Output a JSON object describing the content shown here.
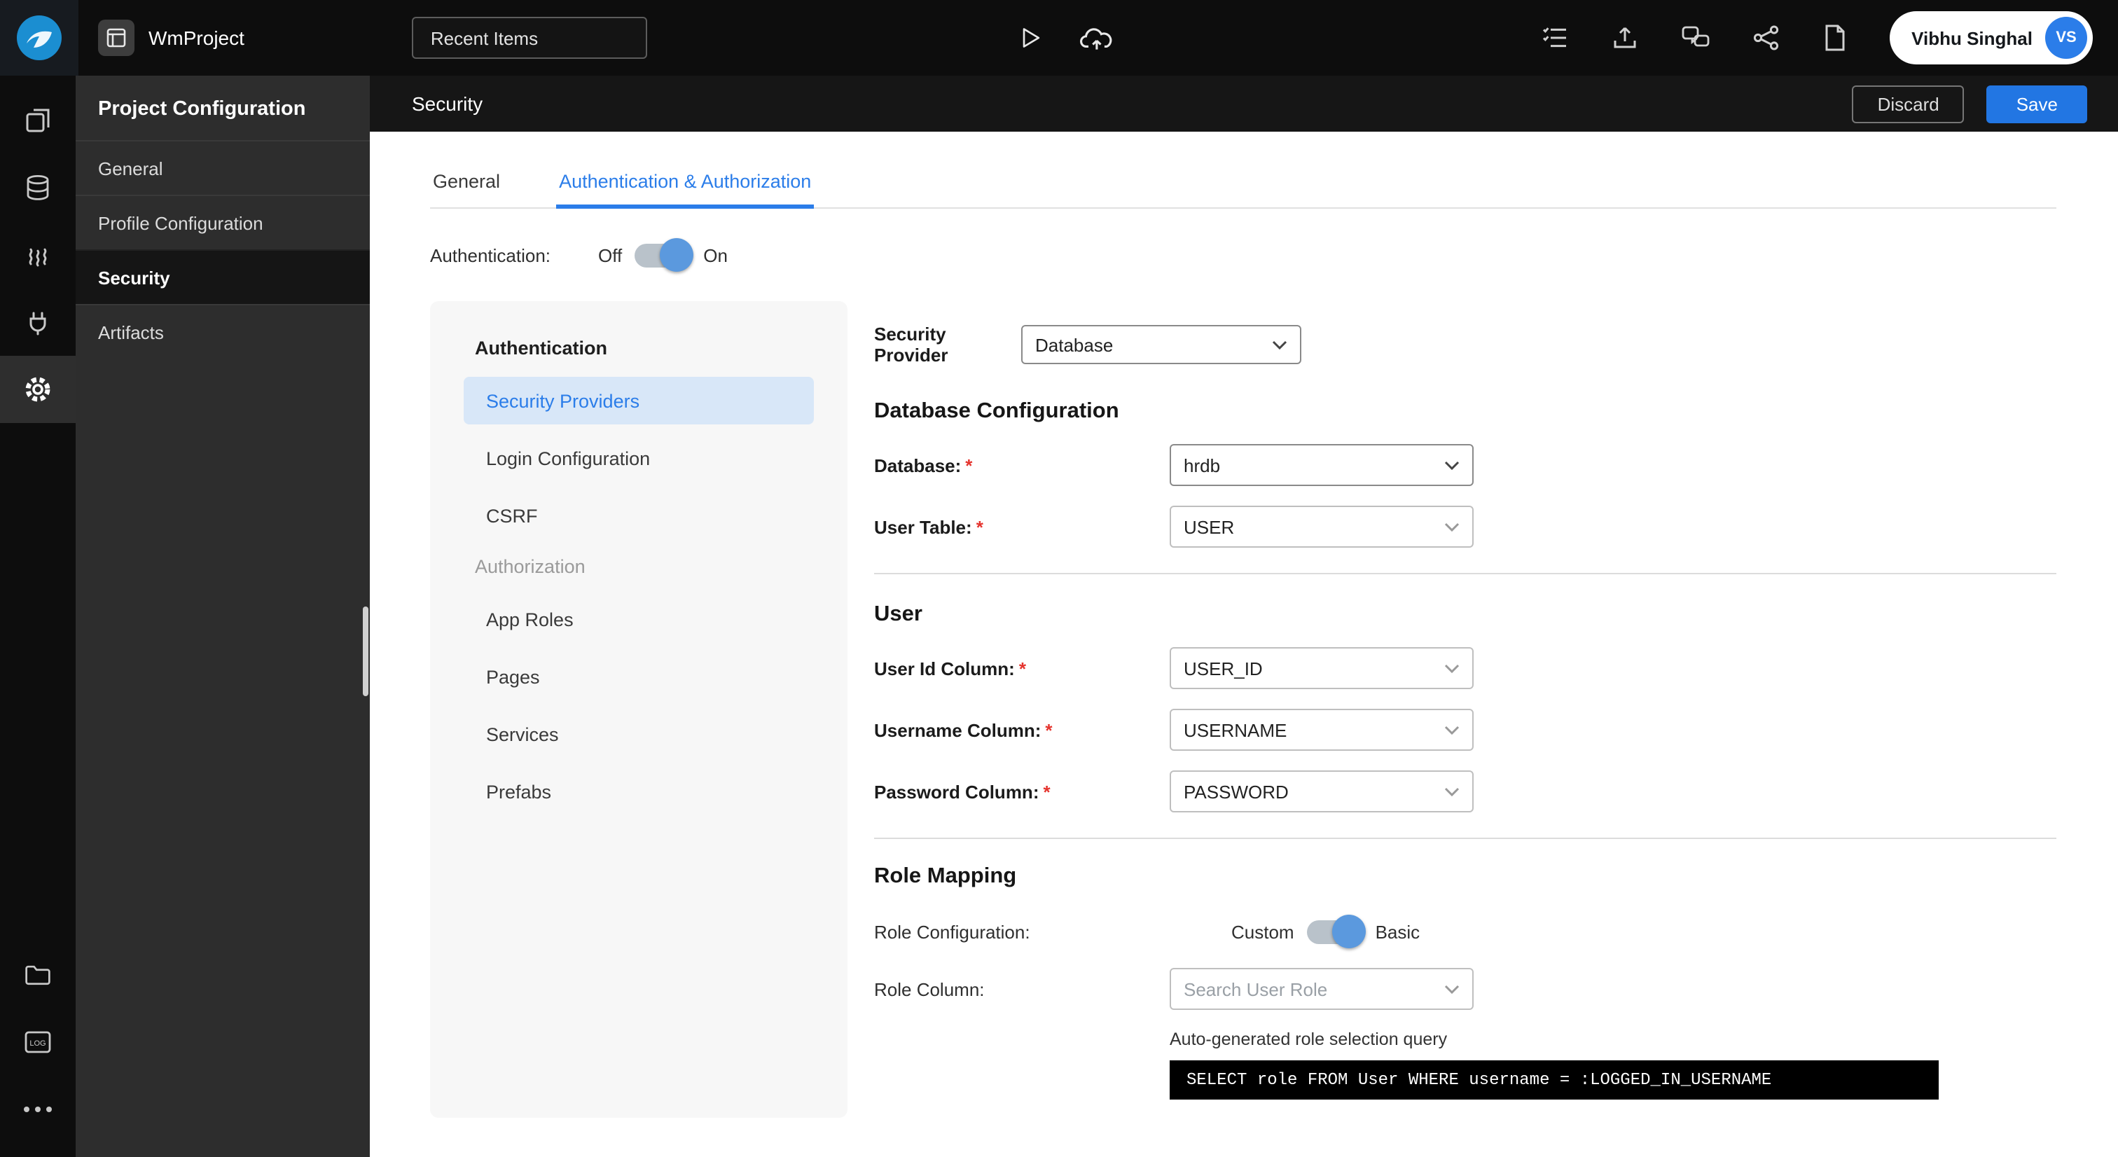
{
  "topbar": {
    "project": "WmProject",
    "recent": "Recent Items",
    "user": "Vibhu Singhal",
    "initials": "VS"
  },
  "sidebar": {
    "title": "Project Configuration",
    "items": [
      "General",
      "Profile Configuration",
      "Security",
      "Artifacts"
    ]
  },
  "header": {
    "title": "Security",
    "discard": "Discard",
    "save": "Save"
  },
  "tabs": {
    "general": "General",
    "auth": "Authentication & Authorization"
  },
  "auth_row": {
    "label": "Authentication:",
    "off": "Off",
    "on": "On",
    "state": "on"
  },
  "left_nav": {
    "auth_header": "Authentication",
    "items_auth": [
      "Security Providers",
      "Login Configuration",
      "CSRF"
    ],
    "selected": "Security Providers",
    "authz_header": "Authorization",
    "items_authz": [
      "App Roles",
      "Pages",
      "Services",
      "Prefabs"
    ]
  },
  "form": {
    "provider_label": "Security Provider",
    "provider_value": "Database",
    "required_marker": "*",
    "db_heading": "Database Configuration",
    "db_fields": [
      {
        "label": "Database:",
        "value": "hrdb",
        "required": true
      },
      {
        "label": "User Table:",
        "value": "USER",
        "required": true
      }
    ],
    "user_heading": "User",
    "user_fields": [
      {
        "label": "User Id Column:",
        "value": "USER_ID",
        "required": true
      },
      {
        "label": "Username Column:",
        "value": "USERNAME",
        "required": true
      },
      {
        "label": "Password Column:",
        "value": "PASSWORD",
        "required": true
      }
    ],
    "role_heading": "Role Mapping",
    "role_config_label": "Role Configuration:",
    "toggle_custom": "Custom",
    "toggle_basic": "Basic",
    "role_toggle_state": "basic",
    "role_column_label": "Role Column:",
    "role_column_placeholder": "Search User Role",
    "query_caption": "Auto-generated role selection query",
    "query_text": "SELECT role FROM User WHERE username = :LOGGED_IN_USERNAME"
  },
  "colors": {
    "accent_blue": "#2b7de9",
    "save_button": "#2276e3",
    "topbar_bg": "#0d0d0d",
    "sidebar_bg": "#2d2d2d",
    "nav_selected_bg": "#d8e7f8",
    "toggle_knob": "#5b99de",
    "code_block_bg": "#000000",
    "required_red": "#e5342e"
  }
}
